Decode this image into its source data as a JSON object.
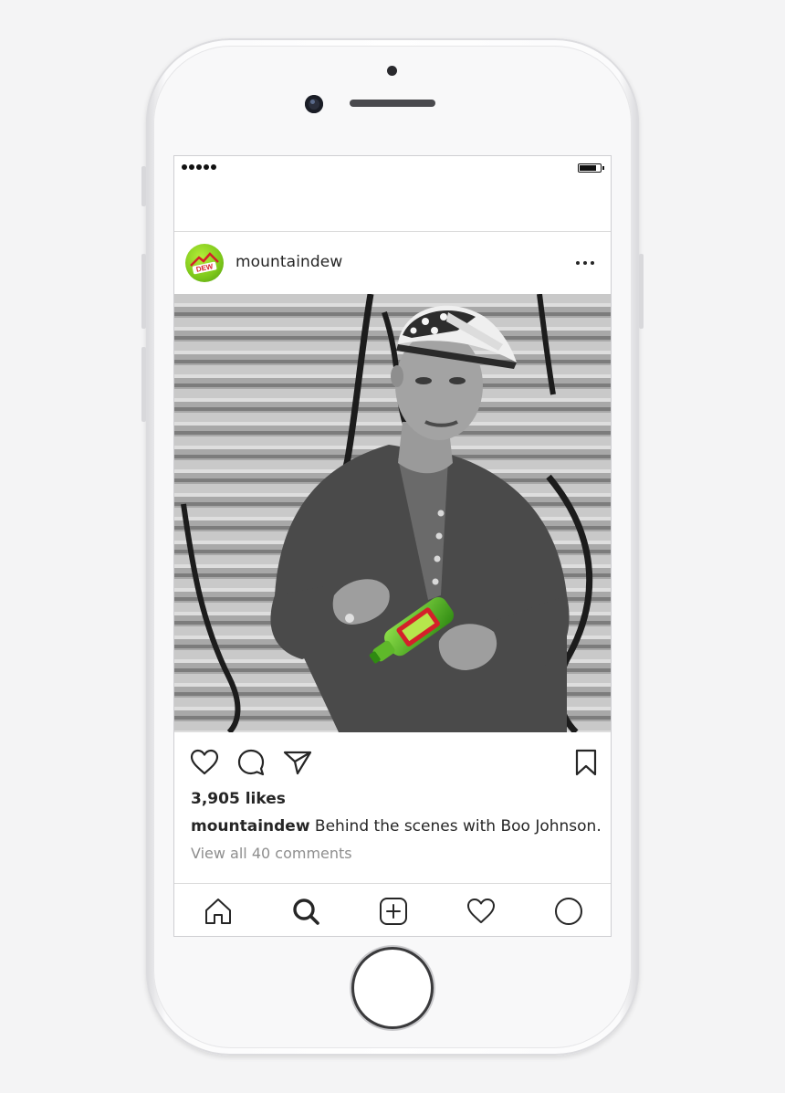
{
  "post": {
    "username": "mountaindew",
    "likes": "3,905 likes",
    "caption_user": "mountaindew",
    "caption_text": " Behind the scenes with Boo Johnson.",
    "comments_link": "View all 40 comments",
    "avatar_logo_text": "MTN DEW"
  },
  "icons": {
    "like": "heart-icon",
    "comment": "comment-bubble-icon",
    "share": "paper-plane-icon",
    "save": "bookmark-icon",
    "more": "more-dots-icon"
  },
  "tabbar": [
    "home-icon",
    "search-icon",
    "add-post-icon",
    "activity-heart-icon",
    "profile-icon"
  ],
  "colors": {
    "brand_green": "#7dc71a",
    "text": "#262626",
    "muted": "#8e8e8e",
    "divider": "#dbdbdb"
  }
}
